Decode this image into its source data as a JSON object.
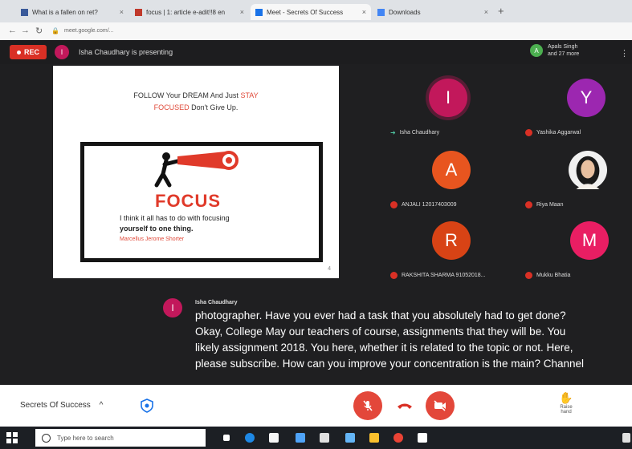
{
  "browser": {
    "tabs": [
      {
        "label": "What is a fallen on ret?",
        "color": "#3a5a9a",
        "active": false
      },
      {
        "label": "focus | 1: article e-adit!!8 en",
        "color": "#c0392b",
        "active": false
      },
      {
        "label": "Meet - Secrets Of Success",
        "color": "#1a73e8",
        "active": true
      },
      {
        "label": "Downloads",
        "color": "#4285f4",
        "active": false
      }
    ],
    "new_tab": "+",
    "url": "meet.google.com/..."
  },
  "meet": {
    "rec_label": "REC",
    "presenting_text": "Isha Chaudhary is presenting",
    "presenter_initial": "I",
    "people_text_line1": "Apals Singh",
    "people_text_line2": "and 27 more",
    "people_initial": "A",
    "slide": {
      "line1_a": "FOLLOW Your DREAM And Just",
      "line1_b": "STAY",
      "line2_a": "FOCUSED",
      "line2_b": "Don't Give Up.",
      "focus_word": "FOCUS",
      "quote_line1": "I think it all has to do with focusing",
      "quote_line2": "yourself to one thing.",
      "quote_author": "Marcellus Jerome Shorter",
      "page_number": "4"
    },
    "participants": [
      {
        "initial": "I",
        "name": "Isha Chaudhary",
        "color": "#c2185b",
        "pinned": true
      },
      {
        "initial": "Y",
        "name": "Yashika Aggarwal",
        "color": "#9c27b0",
        "pinned": false
      },
      {
        "initial": "A",
        "name": "ANJALI 12017403009",
        "color": "#e8551f",
        "pinned": false
      },
      {
        "initial": "",
        "name": "Riya Maan",
        "color": "#2a2a2a",
        "pinned": false
      },
      {
        "initial": "R",
        "name": "RAKSHITA SHARMA 91052018...",
        "color": "#d84315",
        "pinned": false
      },
      {
        "initial": "M",
        "name": "Mukku Bhatia",
        "color": "#e91e63",
        "pinned": false
      }
    ],
    "caption": {
      "speaker": "Isha Chaudhary",
      "speaker_initial": "I",
      "lines": [
        "photographer. Have you ever had a task that you absolutely had to get done?",
        "Okay, College May our teachers of course, assignments that they will be. You",
        "likely assignment 2018. You here, whether it is related to the topic or not. Here,",
        "please subscribe. How can you improve your concentration is the main? Channel"
      ]
    },
    "bottom": {
      "meeting_name": "Secrets Of Success",
      "chevron": "^",
      "raise_hand_label": "Raise hand"
    }
  },
  "taskbar": {
    "search_placeholder": "Type here to search"
  },
  "colors": {
    "meet_bg": "#1f1f21",
    "accent_red": "#e3473a"
  }
}
